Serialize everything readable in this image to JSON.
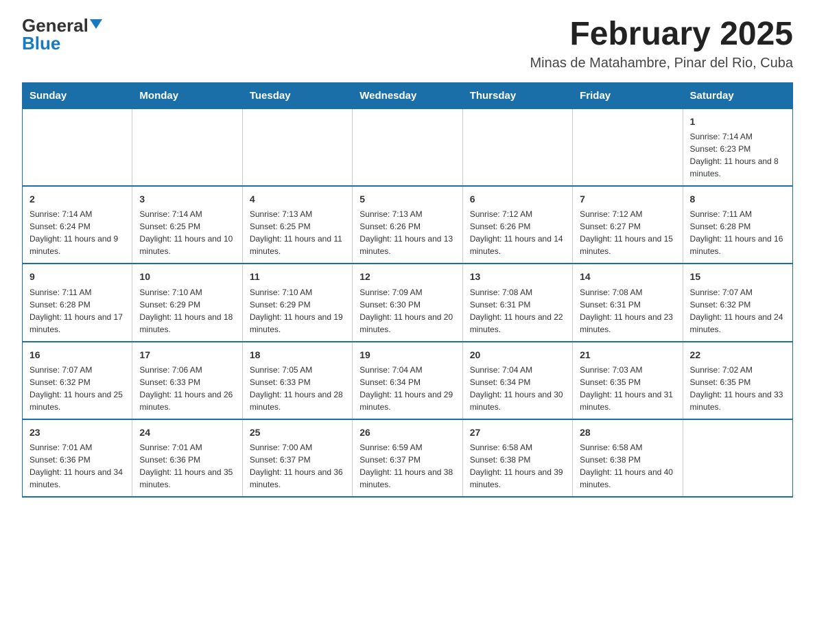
{
  "header": {
    "logo_general": "General",
    "logo_blue": "Blue",
    "title": "February 2025",
    "subtitle": "Minas de Matahambre, Pinar del Rio, Cuba"
  },
  "weekdays": [
    "Sunday",
    "Monday",
    "Tuesday",
    "Wednesday",
    "Thursday",
    "Friday",
    "Saturday"
  ],
  "weeks": [
    [
      {
        "day": "",
        "info": ""
      },
      {
        "day": "",
        "info": ""
      },
      {
        "day": "",
        "info": ""
      },
      {
        "day": "",
        "info": ""
      },
      {
        "day": "",
        "info": ""
      },
      {
        "day": "",
        "info": ""
      },
      {
        "day": "1",
        "info": "Sunrise: 7:14 AM\nSunset: 6:23 PM\nDaylight: 11 hours and 8 minutes."
      }
    ],
    [
      {
        "day": "2",
        "info": "Sunrise: 7:14 AM\nSunset: 6:24 PM\nDaylight: 11 hours and 9 minutes."
      },
      {
        "day": "3",
        "info": "Sunrise: 7:14 AM\nSunset: 6:25 PM\nDaylight: 11 hours and 10 minutes."
      },
      {
        "day": "4",
        "info": "Sunrise: 7:13 AM\nSunset: 6:25 PM\nDaylight: 11 hours and 11 minutes."
      },
      {
        "day": "5",
        "info": "Sunrise: 7:13 AM\nSunset: 6:26 PM\nDaylight: 11 hours and 13 minutes."
      },
      {
        "day": "6",
        "info": "Sunrise: 7:12 AM\nSunset: 6:26 PM\nDaylight: 11 hours and 14 minutes."
      },
      {
        "day": "7",
        "info": "Sunrise: 7:12 AM\nSunset: 6:27 PM\nDaylight: 11 hours and 15 minutes."
      },
      {
        "day": "8",
        "info": "Sunrise: 7:11 AM\nSunset: 6:28 PM\nDaylight: 11 hours and 16 minutes."
      }
    ],
    [
      {
        "day": "9",
        "info": "Sunrise: 7:11 AM\nSunset: 6:28 PM\nDaylight: 11 hours and 17 minutes."
      },
      {
        "day": "10",
        "info": "Sunrise: 7:10 AM\nSunset: 6:29 PM\nDaylight: 11 hours and 18 minutes."
      },
      {
        "day": "11",
        "info": "Sunrise: 7:10 AM\nSunset: 6:29 PM\nDaylight: 11 hours and 19 minutes."
      },
      {
        "day": "12",
        "info": "Sunrise: 7:09 AM\nSunset: 6:30 PM\nDaylight: 11 hours and 20 minutes."
      },
      {
        "day": "13",
        "info": "Sunrise: 7:08 AM\nSunset: 6:31 PM\nDaylight: 11 hours and 22 minutes."
      },
      {
        "day": "14",
        "info": "Sunrise: 7:08 AM\nSunset: 6:31 PM\nDaylight: 11 hours and 23 minutes."
      },
      {
        "day": "15",
        "info": "Sunrise: 7:07 AM\nSunset: 6:32 PM\nDaylight: 11 hours and 24 minutes."
      }
    ],
    [
      {
        "day": "16",
        "info": "Sunrise: 7:07 AM\nSunset: 6:32 PM\nDaylight: 11 hours and 25 minutes."
      },
      {
        "day": "17",
        "info": "Sunrise: 7:06 AM\nSunset: 6:33 PM\nDaylight: 11 hours and 26 minutes."
      },
      {
        "day": "18",
        "info": "Sunrise: 7:05 AM\nSunset: 6:33 PM\nDaylight: 11 hours and 28 minutes."
      },
      {
        "day": "19",
        "info": "Sunrise: 7:04 AM\nSunset: 6:34 PM\nDaylight: 11 hours and 29 minutes."
      },
      {
        "day": "20",
        "info": "Sunrise: 7:04 AM\nSunset: 6:34 PM\nDaylight: 11 hours and 30 minutes."
      },
      {
        "day": "21",
        "info": "Sunrise: 7:03 AM\nSunset: 6:35 PM\nDaylight: 11 hours and 31 minutes."
      },
      {
        "day": "22",
        "info": "Sunrise: 7:02 AM\nSunset: 6:35 PM\nDaylight: 11 hours and 33 minutes."
      }
    ],
    [
      {
        "day": "23",
        "info": "Sunrise: 7:01 AM\nSunset: 6:36 PM\nDaylight: 11 hours and 34 minutes."
      },
      {
        "day": "24",
        "info": "Sunrise: 7:01 AM\nSunset: 6:36 PM\nDaylight: 11 hours and 35 minutes."
      },
      {
        "day": "25",
        "info": "Sunrise: 7:00 AM\nSunset: 6:37 PM\nDaylight: 11 hours and 36 minutes."
      },
      {
        "day": "26",
        "info": "Sunrise: 6:59 AM\nSunset: 6:37 PM\nDaylight: 11 hours and 38 minutes."
      },
      {
        "day": "27",
        "info": "Sunrise: 6:58 AM\nSunset: 6:38 PM\nDaylight: 11 hours and 39 minutes."
      },
      {
        "day": "28",
        "info": "Sunrise: 6:58 AM\nSunset: 6:38 PM\nDaylight: 11 hours and 40 minutes."
      },
      {
        "day": "",
        "info": ""
      }
    ]
  ]
}
